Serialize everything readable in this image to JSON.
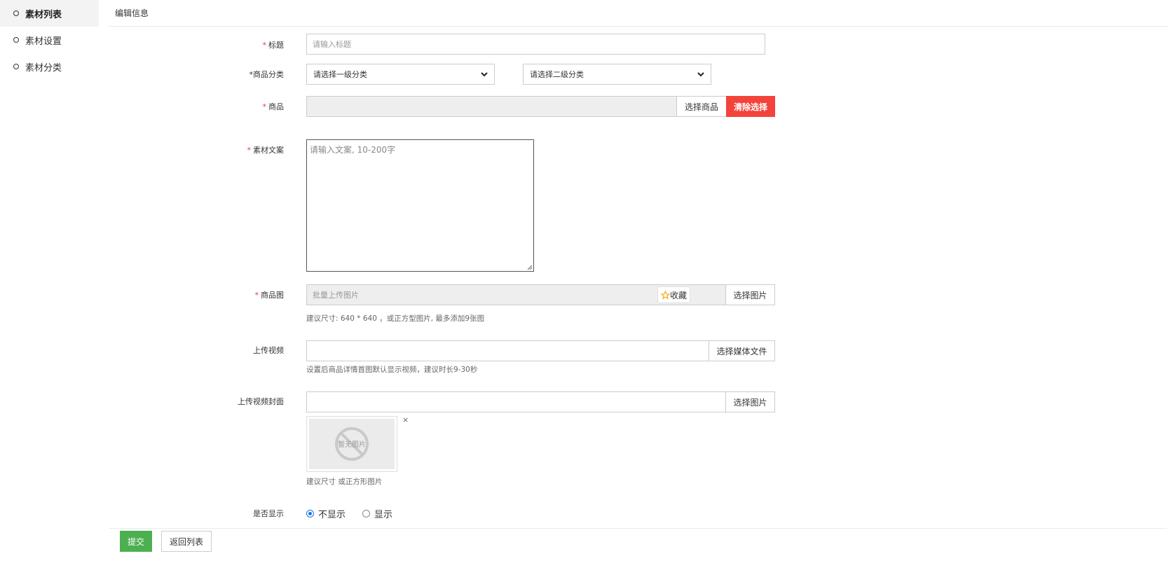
{
  "sidebar": {
    "items": [
      {
        "label": "素材列表",
        "active": true
      },
      {
        "label": "素材设置",
        "active": false
      },
      {
        "label": "素材分类",
        "active": false
      }
    ]
  },
  "header": {
    "title": "编辑信息"
  },
  "form": {
    "required_mark": "*",
    "title": {
      "label": "标题",
      "placeholder": "请输入标题"
    },
    "category": {
      "label": "*商品分类",
      "level1_placeholder": "请选择一级分类",
      "level2_placeholder": "请选择二级分类"
    },
    "product": {
      "label": "商品",
      "select_button": "选择商品",
      "clear_button": "清除选择"
    },
    "copy": {
      "label": "素材文案",
      "placeholder": "请输入文案, 10-200字"
    },
    "product_image": {
      "label": "商品图",
      "placeholder": "批量上传图片",
      "favorite_label": "收藏",
      "select_button": "选择图片",
      "help": "建议尺寸: 640 * 640 ，或正方型图片, 最多添加9张图"
    },
    "video": {
      "label": "上传视频",
      "select_button": "选择媒体文件",
      "help": "设置后商品详情首图默认显示视频，建议时长9-30秒"
    },
    "video_cover": {
      "label": "上传视频封面",
      "select_button": "选择图片",
      "no_image_text": "暂无图片",
      "close_mark": "×",
      "help": "建议尺寸 或正方形图片"
    },
    "display": {
      "label": "是否显示",
      "options": [
        "不显示",
        "显示"
      ],
      "selected": "不显示"
    }
  },
  "actions": {
    "submit": "提交",
    "back": "返回列表"
  },
  "colors": {
    "danger": "#f4433b",
    "primary": "#4caf50",
    "required": "#e4393c",
    "radio": "#1a73e8"
  }
}
